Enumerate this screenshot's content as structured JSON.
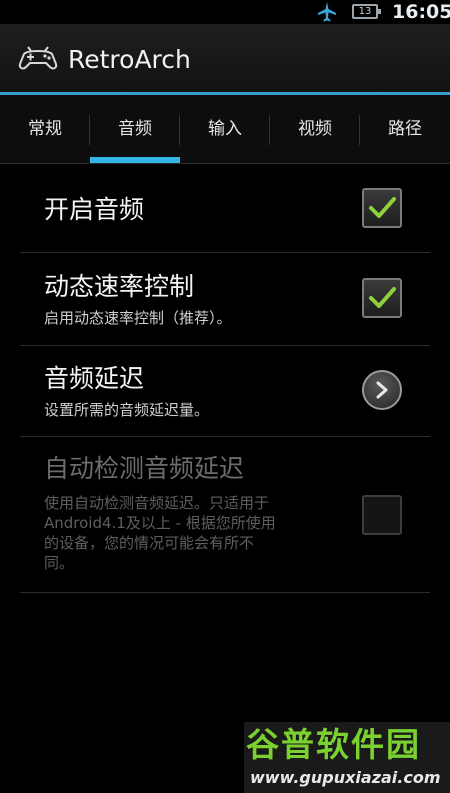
{
  "status_bar": {
    "airplane_icon": "airplane-icon",
    "battery_level": "13",
    "time": "16:05"
  },
  "app": {
    "title": "RetroArch",
    "icon": "gamepad-icon"
  },
  "tabs": [
    {
      "label": "常规",
      "selected": false
    },
    {
      "label": "音频",
      "selected": true
    },
    {
      "label": "输入",
      "selected": false
    },
    {
      "label": "视频",
      "selected": false
    },
    {
      "label": "路径",
      "selected": false
    }
  ],
  "settings": [
    {
      "title": "开启音频",
      "summary": "",
      "control": "checkbox",
      "checked": true,
      "enabled": true
    },
    {
      "title": "动态速率控制",
      "summary": "启用动态速率控制（推荐）。",
      "control": "checkbox",
      "checked": true,
      "enabled": true
    },
    {
      "title": "音频延迟",
      "summary": "设置所需的音频延迟量。",
      "control": "chevron",
      "enabled": true
    },
    {
      "title": "自动检测音频延迟",
      "summary_lines": [
        "使用自动检测音频延迟。只适用于",
        "Android4.1及以上 - 根据您所使用",
        "的设备，您的情况可能会有所不",
        "同。"
      ],
      "control": "checkbox",
      "checked": false,
      "enabled": false
    }
  ],
  "watermark": {
    "brand": "谷普软件园",
    "url": "www.gupuxiazai.com"
  },
  "colors": {
    "accent": "#33b5e5",
    "check": "#8fd13a",
    "watermark_green": "#7ad12f"
  }
}
